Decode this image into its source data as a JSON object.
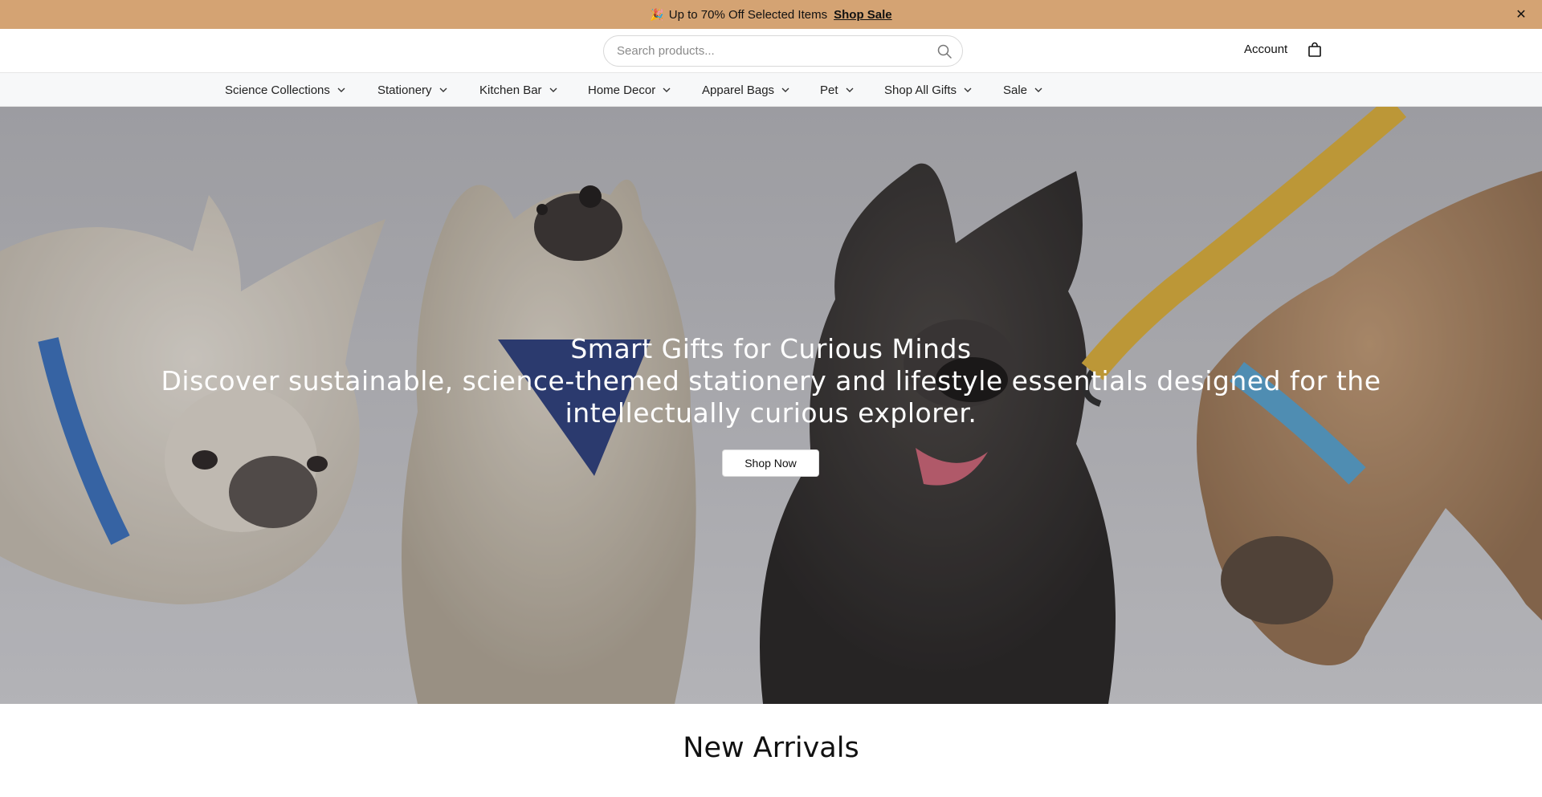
{
  "announcement": {
    "text": "Up to 70% Off Selected Items",
    "link_label": "Shop Sale",
    "party_glyph": "🎉",
    "close_glyph": "✕",
    "background_color": "#d4a373"
  },
  "header": {
    "search_placeholder": "Search products...",
    "account_label": "Account",
    "icons": [
      "search-icon",
      "shopping-bag-icon"
    ]
  },
  "nav": {
    "items": [
      {
        "label": "Science Collections"
      },
      {
        "label": "Stationery"
      },
      {
        "label": "Kitchen Bar"
      },
      {
        "label": "Home Decor"
      },
      {
        "label": "Apparel Bags"
      },
      {
        "label": "Pet"
      },
      {
        "label": "Shop All Gifts"
      },
      {
        "label": "Sale"
      }
    ]
  },
  "hero": {
    "title": "Smart Gifts for Curious Minds",
    "subtitle": "Discover sustainable, science-themed stationery and lifestyle essentials designed for the intellectually curious explorer.",
    "cta_label": "Shop Now"
  },
  "section": {
    "new_arrivals_title": "New Arrivals"
  }
}
